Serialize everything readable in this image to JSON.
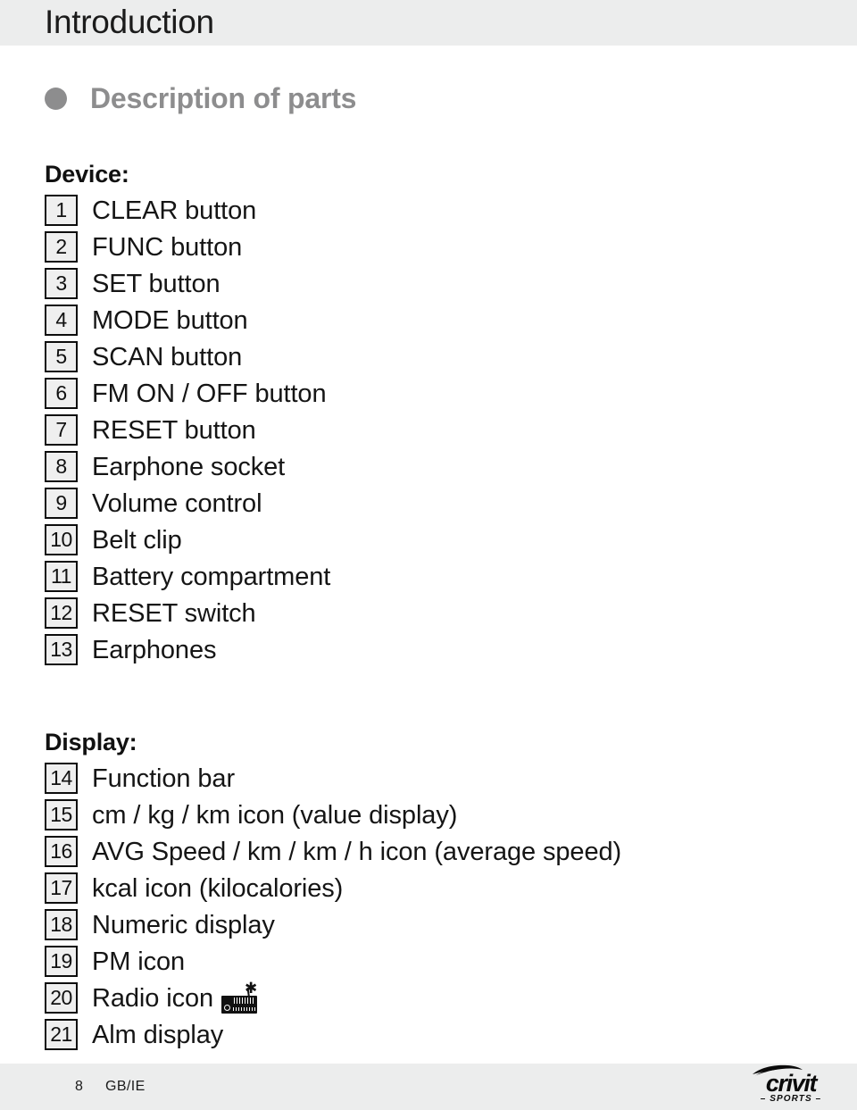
{
  "header": {
    "running_title": "Introduction",
    "band_color": "#eceded"
  },
  "section": {
    "bullet_icon": "filled-circle-bullet",
    "title": "Description of parts",
    "title_color": "#8d8d8e"
  },
  "groups": [
    {
      "title": "Device:",
      "items": [
        {
          "number": "1",
          "label": "CLEAR button"
        },
        {
          "number": "2",
          "label": "FUNC button"
        },
        {
          "number": "3",
          "label": "SET button"
        },
        {
          "number": "4",
          "label": "MODE button"
        },
        {
          "number": "5",
          "label": "SCAN button"
        },
        {
          "number": "6",
          "label": "FM ON / OFF button"
        },
        {
          "number": "7",
          "label": "RESET button"
        },
        {
          "number": "8",
          "label": "Earphone socket"
        },
        {
          "number": "9",
          "label": "Volume control"
        },
        {
          "number": "10",
          "label": "Belt clip"
        },
        {
          "number": "11",
          "label": "Battery compartment"
        },
        {
          "number": "12",
          "label": "RESET switch"
        },
        {
          "number": "13",
          "label": "Earphones"
        }
      ]
    },
    {
      "title": "Display:",
      "items": [
        {
          "number": "14",
          "label": "Function bar"
        },
        {
          "number": "15",
          "label": "cm / kg / km icon (value display)"
        },
        {
          "number": "16",
          "label": "AVG Speed / km / km / h icon (average speed)"
        },
        {
          "number": "17",
          "label": "kcal icon (kilocalories)"
        },
        {
          "number": "18",
          "label": "Numeric display"
        },
        {
          "number": "19",
          "label": "PM icon"
        },
        {
          "number": "20",
          "label": "Radio icon",
          "trailing_icon": "radio-icon"
        },
        {
          "number": "21",
          "label": "Alm display"
        }
      ]
    }
  ],
  "footer": {
    "page_number": "8",
    "locale": "GB/IE",
    "brand": {
      "swoosh_icon": "crivit-swoosh-icon",
      "name": "crivit",
      "subtitle": "– SPORTS –"
    }
  }
}
